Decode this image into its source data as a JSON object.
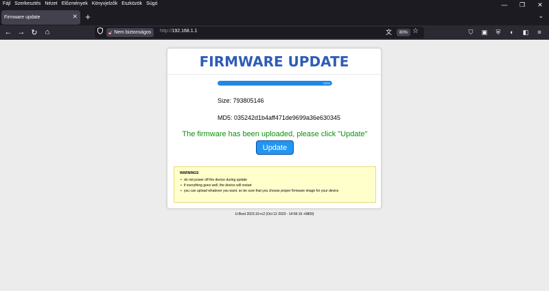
{
  "menu": {
    "items": [
      "Fájl",
      "Szerkesztés",
      "Nézet",
      "Előzmények",
      "Könyvjelzők",
      "Eszközök",
      "Súgó"
    ]
  },
  "window_controls": {
    "minimize": "—",
    "restore": "❐",
    "close": "✕"
  },
  "tabs": [
    {
      "label": "Firmware update",
      "close": "✕"
    }
  ],
  "tab_strip": {
    "new_tab": "+",
    "list_tabs": "⌄"
  },
  "nav": {
    "back": "←",
    "forward": "→",
    "reload": "↻",
    "home": "⌂",
    "security_label": "Nem biztonságos",
    "url_scheme": "http://",
    "url_host": "192.168.1.1",
    "zoom": "80%"
  },
  "toolbar_icons": [
    "save-to-pocket-icon",
    "sidebar-icon",
    "container-icon",
    "extension-icon",
    "bookmarks-icon",
    "menu-icon"
  ],
  "page": {
    "title": "FIRMWARE UPDATE",
    "progress_percent": 100,
    "progress_label": "100%",
    "size_text": "Size: 793805146",
    "md5_text": "MD5: 035242d1b4aff471de9699a36e630345",
    "uploaded_message": "The firmware has been uploaded, please click \"Update\"",
    "update_button": "Update",
    "warnings_title": "WARNINGS",
    "warnings": [
      "do not power off the device during update",
      "if everything goes well, the device will restart",
      "you can upload whatever you want, so be sure that you choose proper firmware image for your device"
    ],
    "footer": "U-Boot 2023.10-rc2 (Oct 12 2023 - 14:56:16 +0800)"
  },
  "colors": {
    "title": "#2e5cb8",
    "progress": "#1e88e5",
    "success_text": "#0a8f0a",
    "button": "#2196f3",
    "warning_bg": "#ffffcc"
  }
}
